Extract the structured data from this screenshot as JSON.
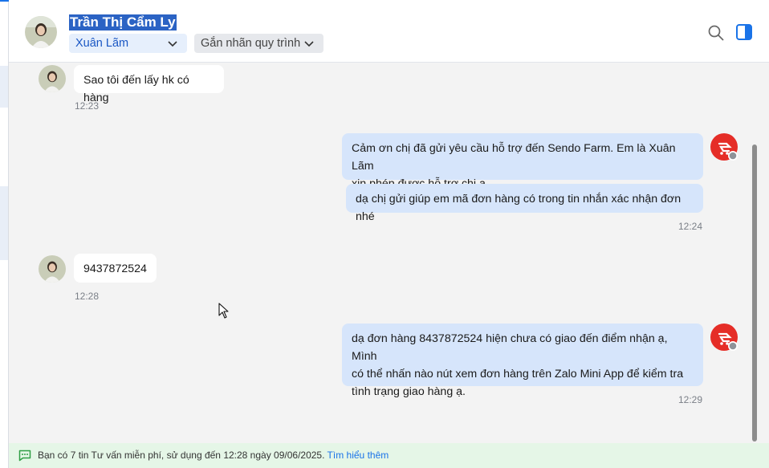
{
  "header": {
    "contact_name": "Trần Thị Cẩm Ly",
    "assignee": "Xuân Lãm",
    "tag_placeholder": "Gắn nhãn quy trình"
  },
  "messages": [
    {
      "direction": "incoming",
      "text": "Sao tôi đến lấy hk có hàng",
      "time": "12:23"
    },
    {
      "direction": "outgoing",
      "text_lines": [
        "Cảm ơn chị đã gửi yêu cầu hỗ trợ đến Sendo Farm. Em là Xuân Lãm",
        "xin phép được hỗ trợ chị ạ."
      ]
    },
    {
      "direction": "outgoing",
      "text": "dạ chị gửi giúp em mã đơn hàng có trong tin nhắn xác nhận đơn nhé",
      "time": "12:24"
    },
    {
      "direction": "incoming",
      "text": "9437872524",
      "time": "12:28"
    },
    {
      "direction": "outgoing",
      "text_lines": [
        "dạ đơn hàng 8437872524 hiện chưa có giao đến điểm nhận ạ, Mình",
        "có thể nhấn nào nút xem đơn hàng trên Zalo Mini App để kiểm tra",
        "tình trạng giao hàng ạ."
      ],
      "time": "12:29"
    }
  ],
  "notice": {
    "text": "Bạn có 7 tin Tư vấn miễn phí, sử dụng đến 12:28 ngày 09/06/2025. ",
    "link": "Tìm hiểu thêm"
  },
  "colors": {
    "outgoing_bubble": "#d6e5fb",
    "incoming_bubble": "#ffffff",
    "brand_red": "#e52d27",
    "link_blue": "#1a73e8"
  }
}
